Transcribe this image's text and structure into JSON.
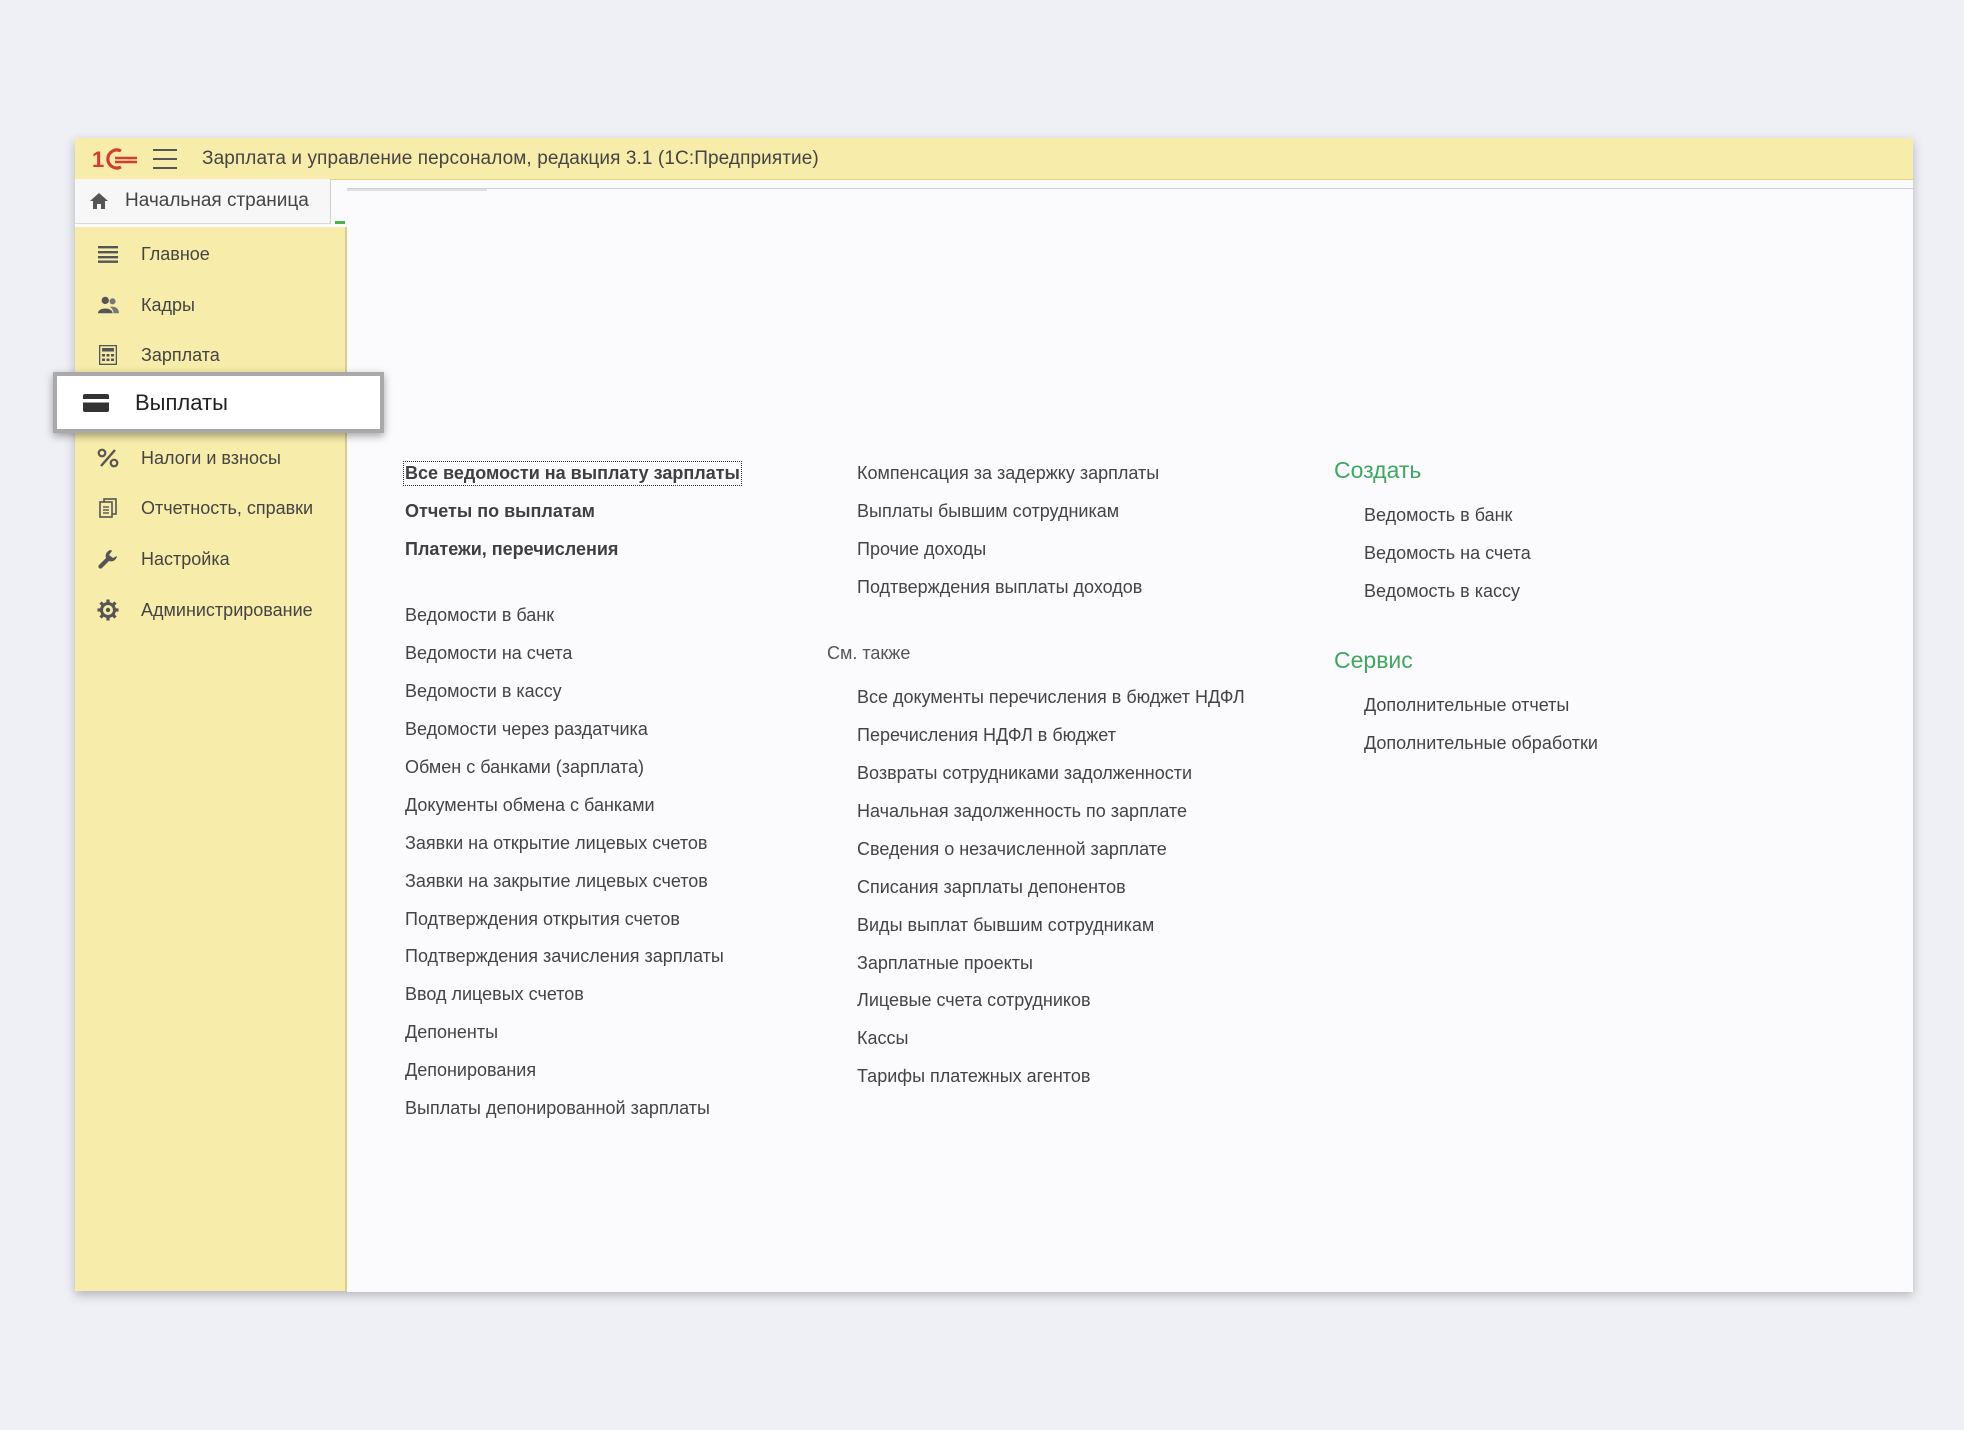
{
  "app": {
    "title": "Зарплата и управление персоналом, редакция 3.1  (1С:Предприятие)",
    "brand_color": "#d63b2f",
    "accent_color": "#3fa75f"
  },
  "home_tab": {
    "label": "Начальная страница",
    "icon": "home-icon"
  },
  "sidebar": {
    "items": [
      {
        "label": "Главное",
        "icon": "list-icon"
      },
      {
        "label": "Кадры",
        "icon": "people-icon"
      },
      {
        "label": "Зарплата",
        "icon": "calculator-icon"
      },
      {
        "label": "Выплаты",
        "icon": "wallet-icon",
        "active": true
      },
      {
        "label": "Налоги и взносы",
        "icon": "percent-icon"
      },
      {
        "label": "Отчетность, справки",
        "icon": "documents-icon"
      },
      {
        "label": "Настройка",
        "icon": "wrench-icon"
      },
      {
        "label": "Администрирование",
        "icon": "gear-icon"
      }
    ]
  },
  "content": {
    "col1_primary": [
      "Все ведомости на выплату зарплаты",
      "Отчеты по выплатам",
      "Платежи, перечисления"
    ],
    "col1_links": [
      "Ведомости в банк",
      "Ведомости на счета",
      "Ведомости в кассу",
      "Ведомости через раздатчика",
      "Обмен с банками (зарплата)",
      "Документы обмена с банками",
      "Заявки на открытие лицевых счетов",
      "Заявки на закрытие лицевых счетов",
      "Подтверждения открытия счетов",
      "Подтверждения зачисления зарплаты",
      "Ввод лицевых счетов",
      "Депоненты",
      "Депонирования",
      "Выплаты депонированной зарплаты"
    ],
    "col2_links": [
      "Компенсация за задержку зарплаты",
      "Выплаты бывшим сотрудникам",
      "Прочие доходы",
      "Подтверждения выплаты доходов"
    ],
    "see_also_label": "См. также",
    "see_also_links": [
      "Все документы перечисления в бюджет НДФЛ",
      "Перечисления НДФЛ в бюджет",
      "Возвраты сотрудниками задолженности",
      "Начальная задолженность по зарплате",
      "Сведения о незачисленной зарплате",
      "Списания зарплаты депонентов",
      "Виды выплат бывшим сотрудникам",
      "Зарплатные проекты",
      "Лицевые счета сотрудников",
      "Кассы",
      "Тарифы платежных агентов"
    ],
    "create_title": "Создать",
    "create_links": [
      "Ведомость в банк",
      "Ведомость на счета",
      "Ведомость в кассу"
    ],
    "service_title": "Сервис",
    "service_links": [
      "Дополнительные отчеты",
      "Дополнительные обработки"
    ]
  }
}
